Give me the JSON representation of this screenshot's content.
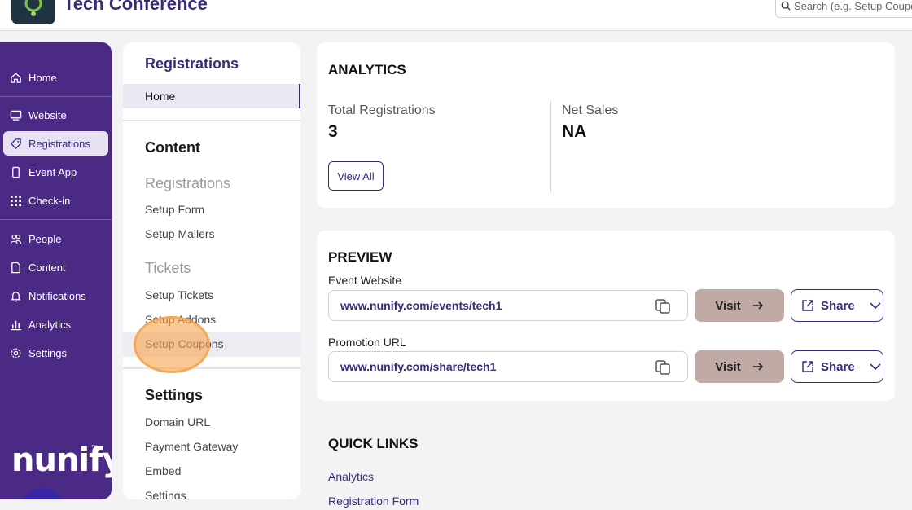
{
  "app": {
    "title": "Tech Conference"
  },
  "search": {
    "placeholder": "Search (e.g. Setup Coupons)"
  },
  "colors": {
    "accent": "#3b2a7a",
    "sidebar": "#4a2a85",
    "visit_button": "#bfaaa5",
    "highlight": "#f6a650"
  },
  "sidebar": {
    "items": [
      {
        "label": "Home",
        "icon": "home-icon"
      },
      {
        "label": "Website",
        "icon": "monitor-icon"
      },
      {
        "label": "Registrations",
        "icon": "ticket-icon",
        "active": true
      },
      {
        "label": "Event App",
        "icon": "phone-icon"
      },
      {
        "label": "Check-in",
        "icon": "qr-icon"
      },
      {
        "label": "People",
        "icon": "people-icon"
      },
      {
        "label": "Content",
        "icon": "document-icon"
      },
      {
        "label": "Notifications",
        "icon": "bell-icon"
      },
      {
        "label": "Analytics",
        "icon": "bar-chart-icon"
      },
      {
        "label": "Settings",
        "icon": "gear-icon"
      }
    ],
    "brand": "nunify",
    "brand_tm": "™"
  },
  "subnav": {
    "title": "Registrations",
    "home": "Home",
    "content_heading": "Content",
    "registrations_group": "Registrations",
    "setup_form": "Setup Form",
    "setup_mailers": "Setup Mailers",
    "tickets_group": "Tickets",
    "setup_tickets": "Setup Tickets",
    "setup_addons": "Setup Addons",
    "setup_coupons": "Setup Coupons",
    "settings_heading": "Settings",
    "domain_url": "Domain URL",
    "payment_gateway": "Payment Gateway",
    "embed": "Embed",
    "settings": "Settings"
  },
  "analytics": {
    "title": "ANALYTICS",
    "total_label": "Total Registrations",
    "total_value": "3",
    "sales_label": "Net Sales",
    "sales_value": "NA",
    "view_all": "View All"
  },
  "preview": {
    "title": "PREVIEW",
    "event_label": "Event Website",
    "event_url": "www.nunify.com/events/tech1",
    "promo_label": "Promotion URL",
    "promo_url": "www.nunify.com/share/tech1",
    "visit": "Visit",
    "share": "Share"
  },
  "quick_links": {
    "title": "QUICK LINKS",
    "links": [
      "Analytics",
      "Registration Form"
    ]
  }
}
